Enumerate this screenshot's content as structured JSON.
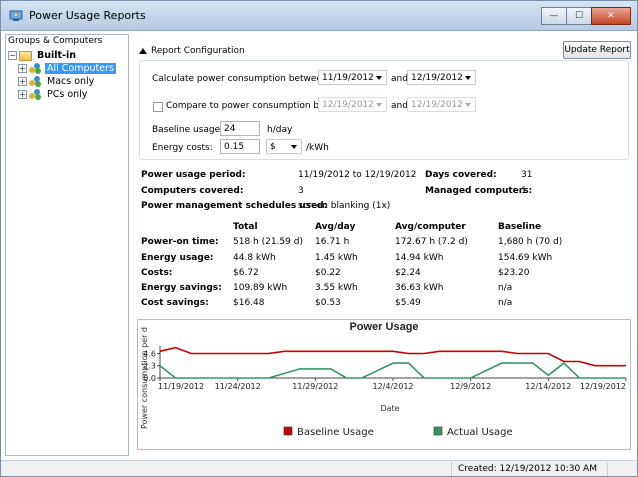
{
  "window": {
    "title": "Power Usage Reports",
    "controls": {
      "minimize": "—",
      "maximize": "☐",
      "close": "✕"
    }
  },
  "tree": {
    "header": "Groups & Computers",
    "root": "Built-in",
    "items": [
      {
        "label": "All Computers",
        "selected": true
      },
      {
        "label": "Macs only",
        "selected": false
      },
      {
        "label": "PCs only",
        "selected": false
      }
    ]
  },
  "config": {
    "section_title": "Report Configuration",
    "update_button": "Update Report",
    "calc_label": "Calculate power consumption between:",
    "calc_from": "11/19/2012",
    "calc_and": "and",
    "calc_to": "12/19/2012",
    "compare_label": "Compare to power consumption between:",
    "compare_from": "12/19/2012",
    "compare_and": "and",
    "compare_to": "12/19/2012",
    "baseline_label": "Baseline usage:",
    "baseline_value": "24",
    "baseline_unit": "h/day",
    "energy_label": "Energy costs:",
    "energy_value": "0.15",
    "currency": "$",
    "energy_unit": "/kWh"
  },
  "summary": {
    "period_label": "Power usage period:",
    "period_value": "11/19/2012 to 12/19/2012",
    "days_label": "Days covered:",
    "days_value": "31",
    "computers_label": "Computers covered:",
    "computers_value": "3",
    "managed_label": "Managed computers:",
    "managed_value": "1",
    "schedules_label": "Power management schedules used:",
    "schedules_value": "screen blanking (1x)"
  },
  "stats": {
    "columns": [
      "Total",
      "Avg/day",
      "Avg/computer",
      "Baseline"
    ],
    "rows": [
      {
        "label": "Power-on time:",
        "values": [
          "518 h (21.59 d)",
          "16.71 h",
          "172.67 h (7.2 d)",
          "1,680 h (70 d)"
        ]
      },
      {
        "label": "Energy usage:",
        "values": [
          "44.8 kWh",
          "1.45 kWh",
          "14.94 kWh",
          "154.69 kWh"
        ]
      },
      {
        "label": "Costs:",
        "values": [
          "$6.72",
          "$0.22",
          "$2.24",
          "$23.20"
        ]
      },
      {
        "label": "Energy savings:",
        "values": [
          "109.89 kWh",
          "3.55 kWh",
          "36.63 kWh",
          "n/a"
        ]
      },
      {
        "label": "Cost savings:",
        "values": [
          "$16.48",
          "$0.53",
          "$5.49",
          "n/a"
        ]
      }
    ]
  },
  "chart_data": {
    "type": "line",
    "title": "Power Usage",
    "xlabel": "Date",
    "ylabel": "Power consumption per d",
    "x_ticks": [
      "11/19/2012",
      "11/24/2012",
      "11/29/2012",
      "12/4/2012",
      "12/9/2012",
      "12/14/2012",
      "12/19/2012"
    ],
    "y_ticks": [
      "0.0",
      "2.3",
      "4.6"
    ],
    "ylim": [
      0,
      6
    ],
    "legend_position": "bottom",
    "series": [
      {
        "name": "Baseline Usage",
        "color": "#cc0000",
        "points": [
          [
            "11/19/2012",
            5.0
          ],
          [
            "11/20/2012",
            5.7
          ],
          [
            "11/21/2012",
            4.6
          ],
          [
            "11/26/2012",
            4.6
          ],
          [
            "11/27/2012",
            5.0
          ],
          [
            "12/4/2012",
            5.0
          ],
          [
            "12/5/2012",
            4.6
          ],
          [
            "12/6/2012",
            4.6
          ],
          [
            "12/7/2012",
            5.0
          ],
          [
            "12/11/2012",
            5.0
          ],
          [
            "12/12/2012",
            4.6
          ],
          [
            "12/14/2012",
            4.6
          ],
          [
            "12/15/2012",
            3.1
          ],
          [
            "12/16/2012",
            3.1
          ],
          [
            "12/17/2012",
            2.3
          ],
          [
            "12/19/2012",
            2.3
          ]
        ]
      },
      {
        "name": "Actual Usage",
        "color": "#339966",
        "points": [
          [
            "11/19/2012",
            2.3
          ],
          [
            "11/20/2012",
            0.0
          ],
          [
            "11/26/2012",
            0.0
          ],
          [
            "11/28/2012",
            1.7
          ],
          [
            "11/30/2012",
            1.7
          ],
          [
            "12/1/2012",
            0.0
          ],
          [
            "12/2/2012",
            0.0
          ],
          [
            "12/4/2012",
            2.8
          ],
          [
            "12/5/2012",
            2.8
          ],
          [
            "12/6/2012",
            0.0
          ],
          [
            "12/9/2012",
            0.0
          ],
          [
            "12/11/2012",
            2.8
          ],
          [
            "12/13/2012",
            2.8
          ],
          [
            "12/14/2012",
            0.5
          ],
          [
            "12/15/2012",
            2.8
          ],
          [
            "12/16/2012",
            0.0
          ],
          [
            "12/19/2012",
            0.0
          ]
        ]
      }
    ]
  },
  "status": {
    "created": "Created: 12/19/2012 10:30 AM"
  }
}
